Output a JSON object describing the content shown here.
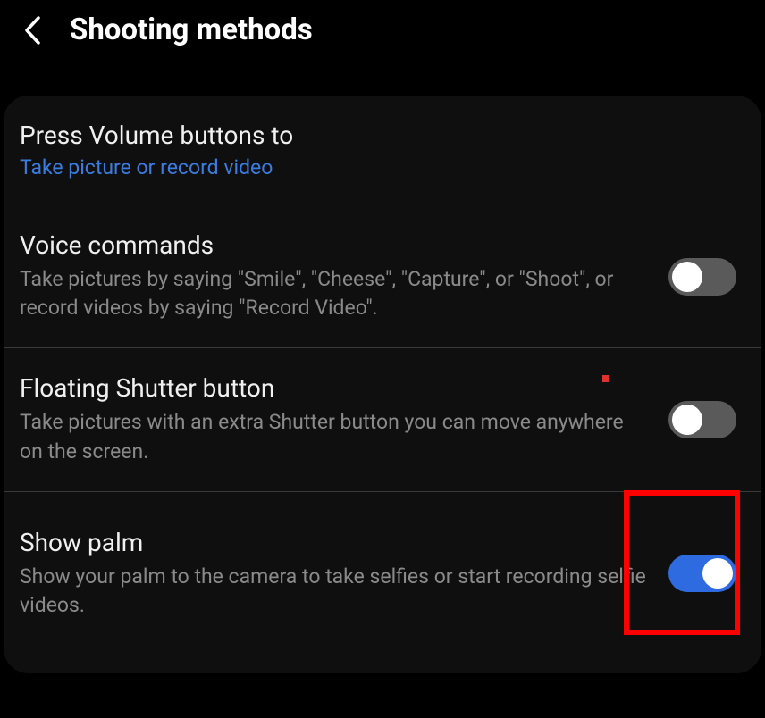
{
  "header": {
    "title": "Shooting methods"
  },
  "settings": {
    "volume": {
      "title": "Press Volume buttons to",
      "value": "Take picture or record video"
    },
    "voice": {
      "title": "Voice commands",
      "desc": "Take pictures by saying \"Smile\", \"Cheese\", \"Capture\", or \"Shoot\", or record videos by saying \"Record Video\".",
      "enabled": false
    },
    "floating": {
      "title": "Floating Shutter button",
      "desc": "Take pictures with an extra Shutter button you can move anywhere on the screen.",
      "enabled": false
    },
    "palm": {
      "title": "Show palm",
      "desc": "Show your palm to the camera to take selfies or start recording selfie videos.",
      "enabled": true
    }
  }
}
